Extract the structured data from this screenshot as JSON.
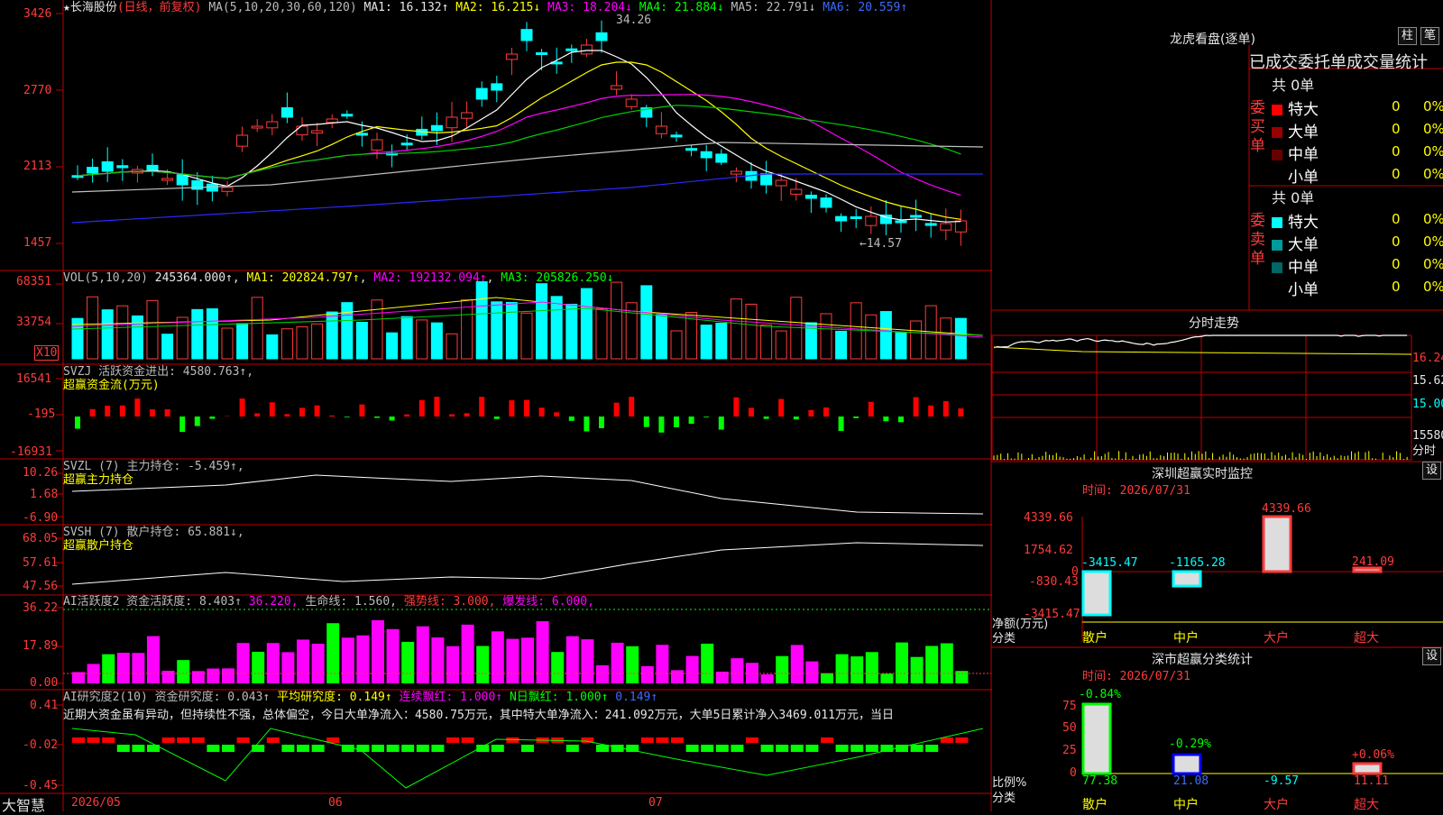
{
  "colors": {
    "up": "#ff3b3b",
    "down": "#00ffff",
    "ma1": "#ffffff",
    "ma2": "#ffff00",
    "ma3": "#ff00ff",
    "ma4": "#00cc00",
    "ma5": "#c0c0c0",
    "ma6": "#2a2aff",
    "grid": "#b00000"
  },
  "main": {
    "stock": "★长海股份",
    "mode": "(日线，前复权)",
    "ma_title": "MA(5,10,20,30,60,120)",
    "ma1": "MA1: 16.132↑",
    "ma2": "MA2: 16.215↓",
    "ma3": "MA3: 18.204↓",
    "ma4": "MA4: 21.884↓",
    "ma5": "MA5: 22.791↓",
    "ma6": "MA6: 20.559↑",
    "yticks": [
      "3426",
      "2770",
      "2113",
      "1457"
    ],
    "high_note": "34.26",
    "low_note": "←14.57"
  },
  "vol": {
    "title": "VOL(5,10,20)",
    "val": "245364.000↑",
    "ma1": "MA1: 202824.797↑",
    "ma2": "MA2: 192132.094↑",
    "ma3": "MA3: 205826.250↓",
    "yticks": [
      "68351",
      "33754"
    ],
    "unit": "X10"
  },
  "svzj": {
    "title": "SVZJ  活跃资金进出: 4580.763↑,",
    "sub": "超赢资金流(万元)",
    "yticks": [
      "16541",
      "-195",
      "-16931"
    ]
  },
  "svzl": {
    "title": "SVZL (7) 主力持仓: -5.459↑,",
    "sub": "超赢主力持仓",
    "yticks": [
      "10.26",
      "1.68",
      "-6.90"
    ]
  },
  "svsh": {
    "title": "SVSH (7) 散户持仓: 65.881↓,",
    "sub": "超赢散户持仓",
    "yticks": [
      "68.05",
      "57.61",
      "47.56"
    ]
  },
  "ai1": {
    "t1": "AI活跃度2 资金活跃度: 8.403↑",
    "t2": "36.220,",
    "t3": "生命线: 1.560,",
    "t4": "强势线: 3.000,",
    "t5": "爆发线: 6.000,",
    "yticks": [
      "36.22",
      "17.89",
      "0.00"
    ]
  },
  "ai2": {
    "t1": "AI研究度2(10) 资金研究度: 0.043↑",
    "t2": "平均研究度: 0.149↑",
    "t3": "连续飘红: 1.000↑",
    "t4": "N日飘红: 1.000↑",
    "t5": "0.149↑",
    "note": "近期大资金虽有异动，但持续性不强，总体偏空，今日大单净流入：4580.75万元，其中特大单净流入：241.092万元，大单5日累计净入3469.011万元，当日",
    "yticks": [
      "0.41",
      "-0.02",
      "-0.45"
    ]
  },
  "xaxis": {
    "brand": "大智慧",
    "labels": [
      "2026/05",
      "06",
      "07"
    ]
  },
  "dragon": {
    "title": "龙虎看盘(逐单)",
    "btn_a": "柱",
    "btn_b": "笔",
    "header": "已成交委托单成交量统计",
    "buy": {
      "label": "委买单",
      "total": "共 0单",
      "rows": [
        {
          "name": "特大",
          "v": "0",
          "p": "0%",
          "c": "#ff0000"
        },
        {
          "name": "大单",
          "v": "0",
          "p": "0%",
          "c": "#990000"
        },
        {
          "name": "中单",
          "v": "0",
          "p": "0%",
          "c": "#660000"
        },
        {
          "name": "小单",
          "v": "0",
          "p": "0%",
          "c": "#000000"
        }
      ]
    },
    "sell": {
      "label": "委卖单",
      "total": "共 0单",
      "rows": [
        {
          "name": "特大",
          "v": "0",
          "p": "0%",
          "c": "#00ffff"
        },
        {
          "name": "大单",
          "v": "0",
          "p": "0%",
          "c": "#009999"
        },
        {
          "name": "中单",
          "v": "0",
          "p": "0%",
          "c": "#006666"
        },
        {
          "name": "小单",
          "v": "0",
          "p": "0%",
          "c": "#000000"
        }
      ]
    }
  },
  "intraday": {
    "title": "分时走势",
    "yticks": [
      "16.24",
      "15.62",
      "15.00"
    ],
    "vol": "15580",
    "unit": "分时"
  },
  "monitor": {
    "title": "深圳超赢实时监控",
    "btn": "设",
    "time": "时间: 2026/07/31",
    "yticks": [
      "4339.66",
      "1754.62",
      "0",
      "-830.43",
      "-3415.47"
    ],
    "ylabel": "净额(万元)",
    "xlabel": "分类",
    "bars": [
      {
        "name": "散户",
        "v": "-3415.47"
      },
      {
        "name": "中户",
        "v": "-1165.28"
      },
      {
        "name": "大户",
        "v": "4339.66"
      },
      {
        "name": "超大",
        "v": "241.09"
      }
    ]
  },
  "classify": {
    "title": "深市超赢分类统计",
    "btn": "设",
    "time": "时间: 2026/07/31",
    "yticks": [
      "75",
      "50",
      "25",
      "0"
    ],
    "ylabel": "比例%",
    "xlabel": "分类",
    "bars": [
      {
        "name": "散户",
        "top": "-0.84%",
        "bot": "77.38"
      },
      {
        "name": "中户",
        "top": "-0.29%",
        "bot": "21.08"
      },
      {
        "name": "大户",
        "top": "",
        "bot": "-9.57"
      },
      {
        "name": "超大",
        "top": "+0.06%",
        "bot": "11.11"
      }
    ]
  }
}
